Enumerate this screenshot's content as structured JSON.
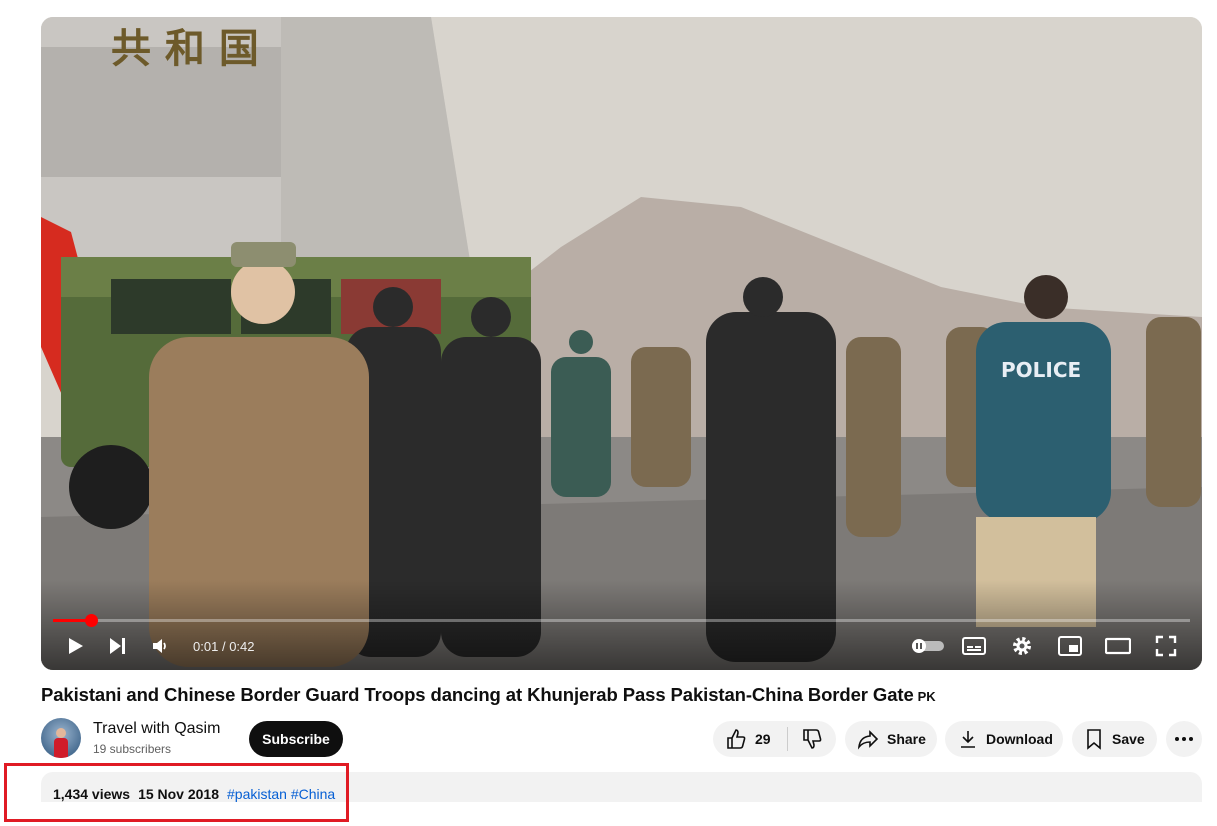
{
  "player": {
    "time_current": "0:01",
    "time_separator": "/",
    "time_total": "0:42",
    "progress_fraction": 0.033,
    "accent_color": "#ff0000",
    "scene_text": {
      "gate_characters": "共 和 国",
      "jacket_label": "POLICE"
    },
    "icons": [
      "play-icon",
      "next-icon",
      "volume-icon",
      "autoplay-toggle-icon",
      "subtitles-icon",
      "settings-icon",
      "miniplayer-icon",
      "theater-icon",
      "fullscreen-icon"
    ]
  },
  "video": {
    "title": "Pakistani and Chinese Border Guard Troops dancing at Khunjerab Pass Pakistan-China Border Gate",
    "title_flag": "PK"
  },
  "channel": {
    "name": "Travel with Qasim",
    "subscribers": "19 subscribers",
    "subscribe_label": "Subscribe"
  },
  "actions": {
    "like_count": "29",
    "share_label": "Share",
    "download_label": "Download",
    "save_label": "Save"
  },
  "description": {
    "views": "1,434 views",
    "date": "15 Nov 2018",
    "tags": [
      "#pakistan",
      "#China"
    ]
  },
  "annotation": {
    "highlight_color": "#e01b24"
  }
}
